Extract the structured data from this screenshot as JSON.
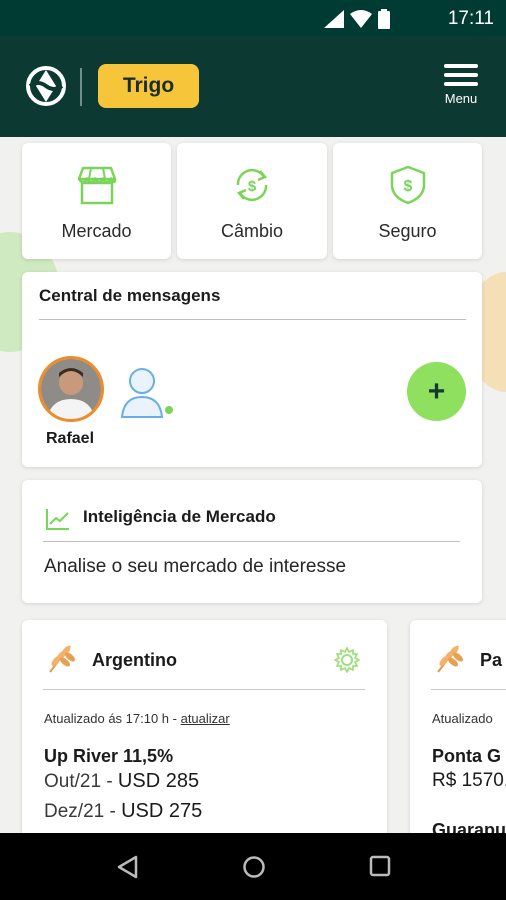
{
  "status_bar": {
    "time": "17:11"
  },
  "header": {
    "commodity": "Trigo",
    "menu_label": "Menu"
  },
  "quick_access": [
    {
      "label": "Mercado",
      "icon": "store-icon"
    },
    {
      "label": "Câmbio",
      "icon": "exchange-icon"
    },
    {
      "label": "Seguro",
      "icon": "shield-dollar-icon"
    }
  ],
  "messages": {
    "title": "Central de mensagens",
    "contacts": [
      {
        "name": "Rafael"
      }
    ],
    "add_label": "+"
  },
  "intelligence": {
    "title": "Inteligência de Mercado",
    "subtitle": "Analise o seu mercado de interesse"
  },
  "markets": [
    {
      "name": "Argentino",
      "updated_prefix": "Atualizado ás 17:10 h - ",
      "update_link": "atualizar",
      "product": "Up River 11,5%",
      "prices": [
        {
          "month": "Out/21 - ",
          "value": "USD 285"
        },
        {
          "month": "Dez/21 - ",
          "value": "USD 275"
        }
      ]
    },
    {
      "name": "Pa",
      "updated_prefix": "Atualizado",
      "product": "Ponta G",
      "price": "R$ 1570.",
      "next_product": "Guarapu"
    }
  ],
  "colors": {
    "header": "#0c3a33",
    "accent_yellow": "#f6c53a",
    "accent_green": "#8ee05e",
    "icon_green": "#7bd45a"
  }
}
